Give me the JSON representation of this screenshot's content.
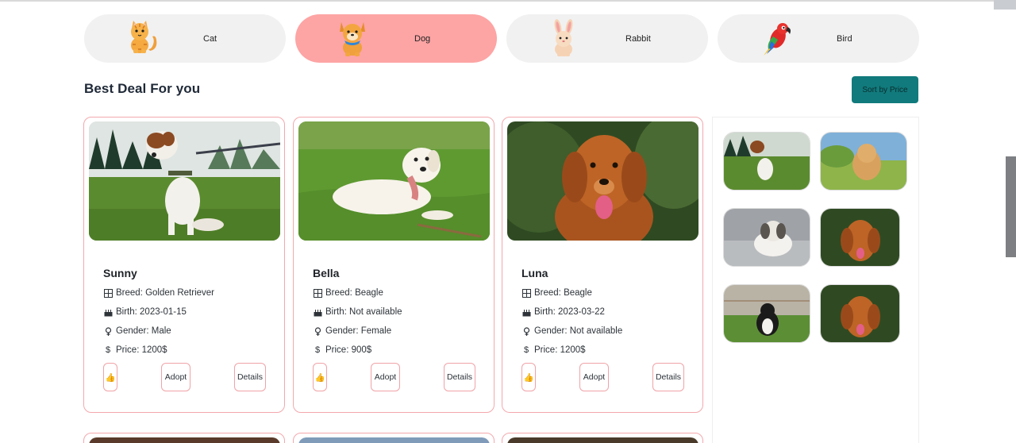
{
  "categories": [
    {
      "label": "Cat",
      "icon": "cat-icon",
      "active": false
    },
    {
      "label": "Dog",
      "icon": "dog-icon",
      "active": true
    },
    {
      "label": "Rabbit",
      "icon": "rabbit-icon",
      "active": false
    },
    {
      "label": "Bird",
      "icon": "parrot-icon",
      "active": false
    }
  ],
  "section": {
    "title": "Best Deal For you",
    "sort_label": "Sort by Price"
  },
  "pets": [
    {
      "name": "Sunny",
      "breed": "Breed: Golden Retriever",
      "birth": "Birth: 2023-01-15",
      "gender": "Gender: Male",
      "price": "Price: 1200$",
      "photo": "jack-russell-on-leash"
    },
    {
      "name": "Bella",
      "breed": "Breed: Beagle",
      "birth": "Birth: Not available",
      "gender": "Gender: Female",
      "price": "Price: 900$",
      "photo": "labrador-lying-in-grass"
    },
    {
      "name": "Luna",
      "breed": "Breed: Beagle",
      "birth": "Birth: 2023-03-22",
      "gender": "Gender: Not available",
      "price": "Price: 1200$",
      "photo": "golden-retriever-portrait"
    }
  ],
  "buttons": {
    "like_icon": "thumbs-up-icon",
    "adopt": "Adopt",
    "details": "Details"
  },
  "attr_icons": {
    "breed": "grid-icon",
    "birth": "cake-icon",
    "gender": "gender-icon",
    "price": "dollar-icon"
  },
  "gallery": [
    "jack-russell",
    "golden-running",
    "shih-tzu",
    "golden-retriever",
    "border-collie",
    "golden-retriever"
  ],
  "colors": {
    "accent": "#117a7c",
    "active_pill": "#fda4a4",
    "card_border": "#f3a8ad",
    "pill_bg": "#f1f1f1"
  }
}
